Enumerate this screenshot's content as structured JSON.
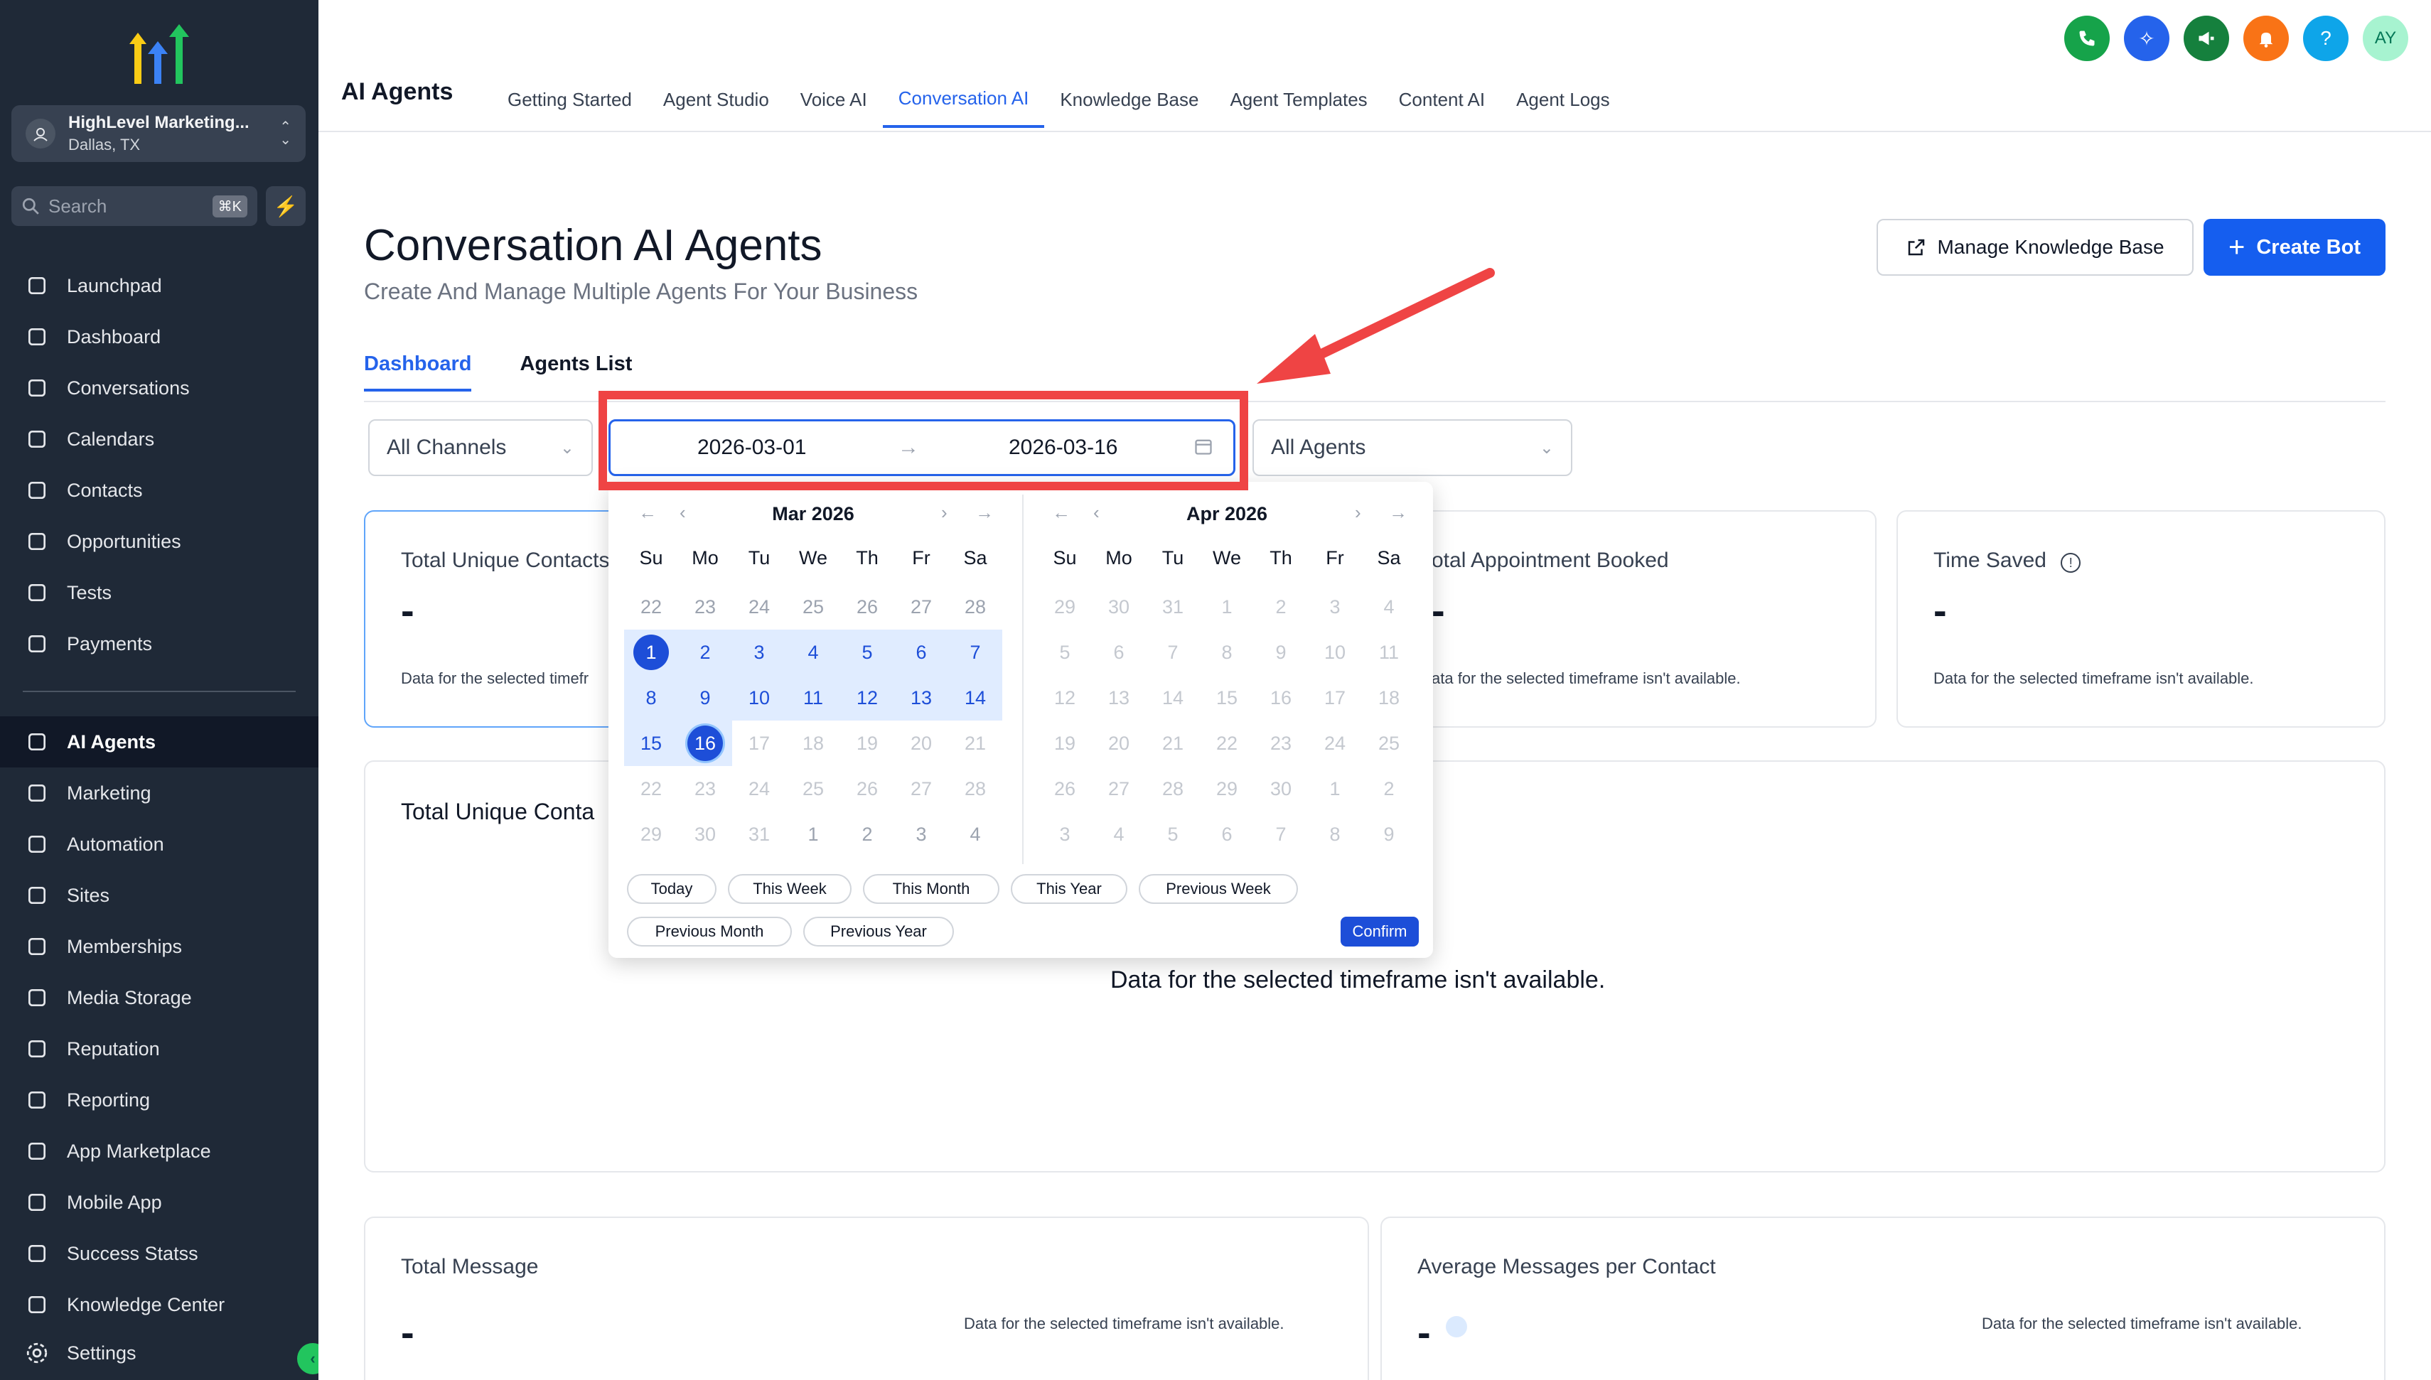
{
  "sidebar": {
    "location": {
      "name": "HighLevel Marketing...",
      "city": "Dallas, TX"
    },
    "search": {
      "placeholder": "Search",
      "shortcut": "⌘K"
    },
    "items_top": [
      {
        "label": "Launchpad",
        "icon": "launchpad-icon"
      },
      {
        "label": "Dashboard",
        "icon": "dashboard-icon"
      },
      {
        "label": "Conversations",
        "icon": "chat-icon"
      },
      {
        "label": "Calendars",
        "icon": "calendar-icon"
      },
      {
        "label": "Contacts",
        "icon": "contacts-icon"
      },
      {
        "label": "Opportunities",
        "icon": "opportunities-icon"
      },
      {
        "label": "Tests",
        "icon": "cube-icon"
      },
      {
        "label": "Payments",
        "icon": "receipt-icon"
      }
    ],
    "items_bottom": [
      {
        "label": "AI Agents",
        "icon": "sparkle-icon",
        "active": true
      },
      {
        "label": "Marketing",
        "icon": "send-icon"
      },
      {
        "label": "Automation",
        "icon": "automation-icon"
      },
      {
        "label": "Sites",
        "icon": "sites-icon"
      },
      {
        "label": "Memberships",
        "icon": "award-icon"
      },
      {
        "label": "Media Storage",
        "icon": "image-icon"
      },
      {
        "label": "Reputation",
        "icon": "star-icon"
      },
      {
        "label": "Reporting",
        "icon": "trend-icon"
      },
      {
        "label": "App Marketplace",
        "icon": "grid-icon"
      },
      {
        "label": "Mobile App",
        "icon": "phone-icon"
      },
      {
        "label": "Success Statss",
        "icon": "bar-chart-icon"
      },
      {
        "label": "Knowledge Center",
        "icon": "book-icon"
      }
    ],
    "settings_label": "Settings"
  },
  "topbar": {
    "app_title": "AI Agents",
    "tabs": [
      "Getting Started",
      "Agent Studio",
      "Voice AI",
      "Conversation AI",
      "Knowledge Base",
      "Agent Templates",
      "Content AI",
      "Agent Logs"
    ],
    "active_tab": "Conversation AI",
    "avatar_initials": "AY"
  },
  "colors": {
    "accent": "#155eef",
    "sidebar_bg": "#1f2937",
    "highlight_red": "#ef4444"
  },
  "main": {
    "title": "Conversation AI Agents",
    "subtitle": "Create And Manage Multiple Agents For Your Business",
    "manage_kb_label": "Manage Knowledge Base",
    "create_bot_label": "Create Bot",
    "subtabs": [
      "Dashboard",
      "Agents List"
    ],
    "channels_select": "All Channels",
    "agents_select": "All Agents",
    "date_start": "2026-03-01",
    "date_end": "2026-03-16",
    "cards": {
      "unique_contacts": {
        "title": "Total Unique Contacts",
        "value": "-",
        "note": "Data for the selected timefr"
      },
      "appointment": {
        "title": "otal Appointment Booked",
        "value": "-",
        "note": "ata for the selected timeframe isn't available."
      },
      "time_saved": {
        "title": "Time Saved",
        "value": "-",
        "note": "Data for the selected timeframe isn't available."
      },
      "unique_chart": {
        "title": "Total Unique Conta",
        "note": "Data for the selected timeframe isn't available."
      },
      "total_message": {
        "title": "Total Message",
        "value": "-",
        "note": "Data for the selected timeframe isn't available."
      },
      "avg_messages": {
        "title": "Average Messages per Contact",
        "value": "-",
        "note": "Data for the selected timeframe isn't available."
      }
    }
  },
  "calendar": {
    "dow": [
      "Su",
      "Mo",
      "Tu",
      "We",
      "Th",
      "Fr",
      "Sa"
    ],
    "left_title": "Mar 2026",
    "right_title": "Apr 2026",
    "left_days": [
      "22",
      "23",
      "24",
      "25",
      "26",
      "27",
      "28",
      "1",
      "2",
      "3",
      "4",
      "5",
      "6",
      "7",
      "8",
      "9",
      "10",
      "11",
      "12",
      "13",
      "14",
      "15",
      "16",
      "17",
      "18",
      "19",
      "20",
      "21",
      "22",
      "23",
      "24",
      "25",
      "26",
      "27",
      "28",
      "29",
      "30",
      "31",
      "1",
      "2",
      "3",
      "4"
    ],
    "right_days": [
      "29",
      "30",
      "31",
      "1",
      "2",
      "3",
      "4",
      "5",
      "6",
      "7",
      "8",
      "9",
      "10",
      "11",
      "12",
      "13",
      "14",
      "15",
      "16",
      "17",
      "18",
      "19",
      "20",
      "21",
      "22",
      "23",
      "24",
      "25",
      "26",
      "27",
      "28",
      "29",
      "30",
      "1",
      "2",
      "3",
      "4",
      "5",
      "6",
      "7",
      "8",
      "9"
    ],
    "presets": [
      "Today",
      "This Week",
      "This Month",
      "This Year",
      "Previous Week",
      "Previous Month",
      "Previous Year"
    ],
    "confirm_label": "Confirm"
  }
}
